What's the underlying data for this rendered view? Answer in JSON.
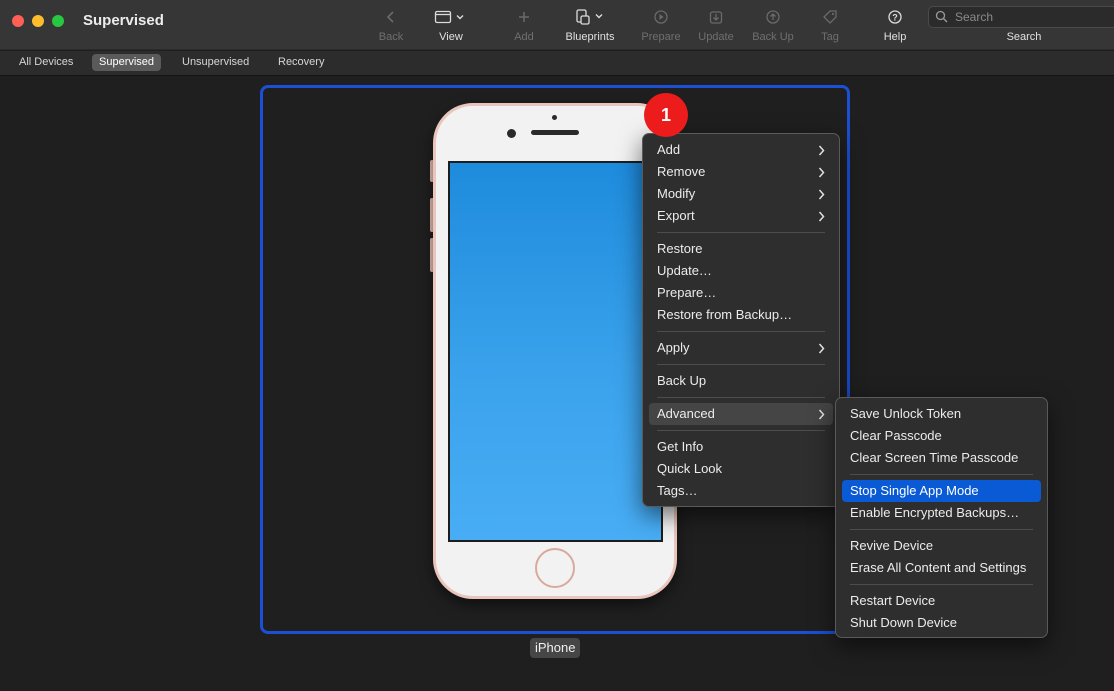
{
  "window": {
    "title": "Supervised"
  },
  "toolbar": {
    "back": {
      "label": "Back",
      "icon": "chevron-left-icon",
      "enabled": false
    },
    "view": {
      "label": "View",
      "icon": "window-icon",
      "enabled": true
    },
    "add": {
      "label": "Add",
      "icon": "plus-icon",
      "enabled": false
    },
    "blueprints": {
      "label": "Blueprints",
      "icon": "blueprint-icon",
      "enabled": true
    },
    "prepare": {
      "label": "Prepare",
      "icon": "prepare-icon",
      "enabled": false
    },
    "update": {
      "label": "Update",
      "icon": "update-icon",
      "enabled": false
    },
    "backup": {
      "label": "Back Up",
      "icon": "backup-icon",
      "enabled": false
    },
    "tag": {
      "label": "Tag",
      "icon": "tag-icon",
      "enabled": false
    },
    "help": {
      "label": "Help",
      "icon": "help-icon",
      "enabled": true
    },
    "search": {
      "placeholder": "Search",
      "label": "Search"
    }
  },
  "tabs": {
    "all_devices": "All Devices",
    "supervised": "Supervised",
    "unsupervised": "Unsupervised",
    "recovery": "Recovery",
    "active": "Supervised"
  },
  "device": {
    "name": "iPhone",
    "selected": true,
    "accent": "#1a4fd6"
  },
  "badge": {
    "number": "1",
    "color": "#ec1c1c"
  },
  "context_menu": {
    "add": "Add",
    "remove": "Remove",
    "modify": "Modify",
    "export": "Export",
    "restore": "Restore",
    "update": "Update…",
    "prepare": "Prepare…",
    "restore_backup": "Restore from Backup…",
    "apply": "Apply",
    "backup": "Back Up",
    "advanced": "Advanced",
    "get_info": "Get Info",
    "quick_look": "Quick Look",
    "tags": "Tags…"
  },
  "advanced_menu": {
    "save_unlock_token": "Save Unlock Token",
    "clear_passcode": "Clear Passcode",
    "clear_screen_time": "Clear Screen Time Passcode",
    "stop_single_app": "Stop Single App Mode",
    "enable_encrypted": "Enable Encrypted Backups…",
    "revive": "Revive Device",
    "erase": "Erase All Content and Settings",
    "restart": "Restart Device",
    "shutdown": "Shut Down Device",
    "highlighted": "Stop Single App Mode",
    "highlight_color": "#0a5ad6"
  }
}
